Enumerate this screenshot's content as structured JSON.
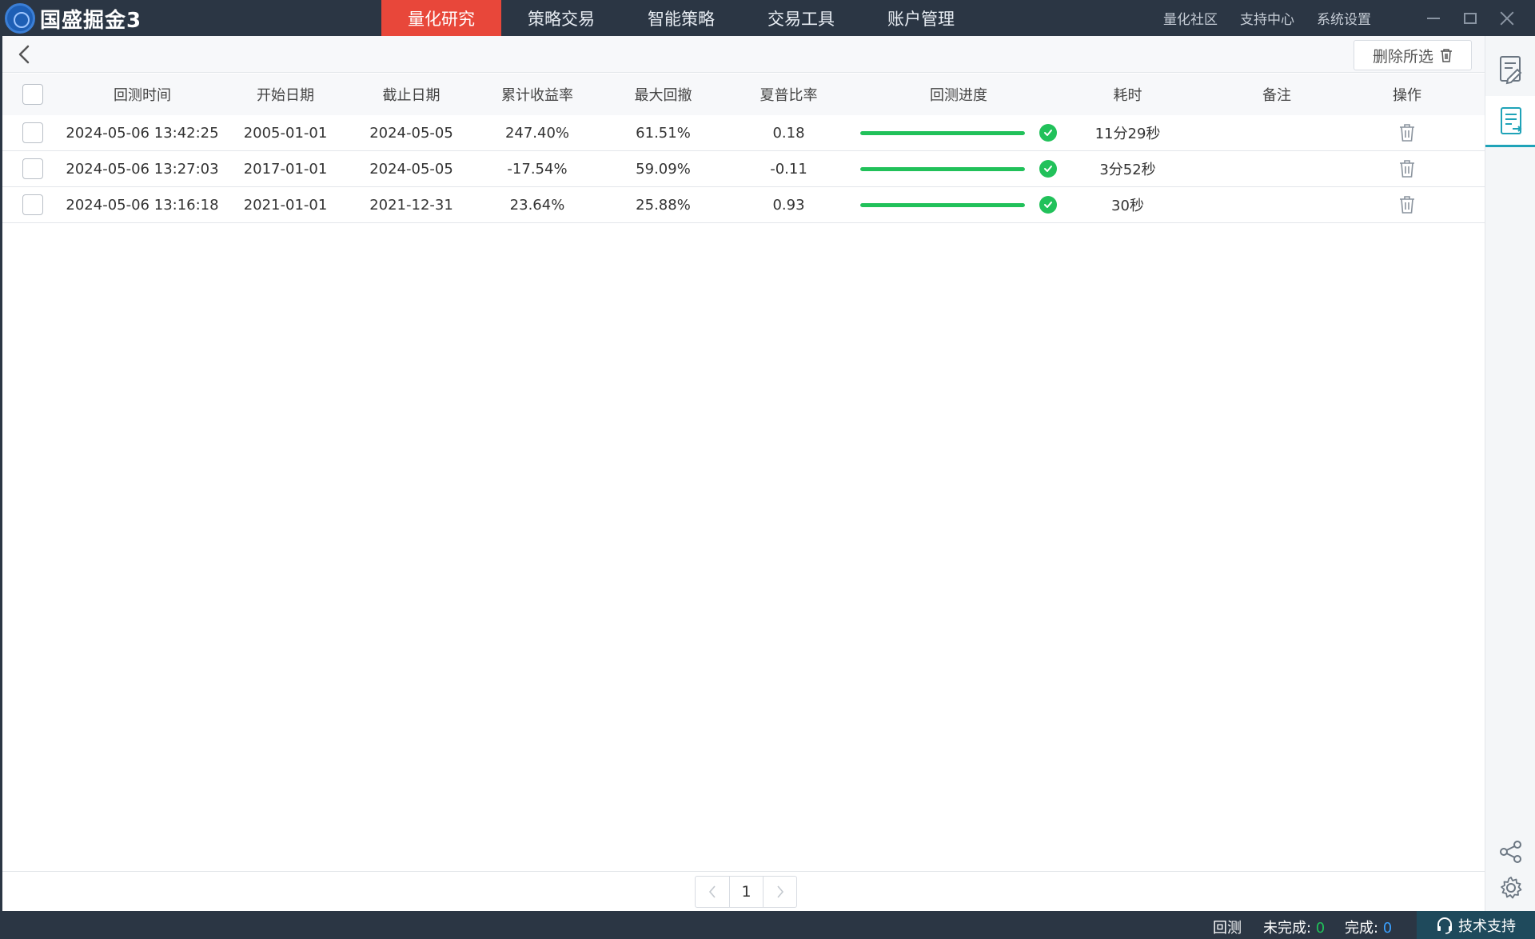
{
  "app": {
    "title": "国盛掘金3"
  },
  "nav": {
    "tabs": [
      {
        "label": "量化研究",
        "active": true
      },
      {
        "label": "策略交易",
        "active": false
      },
      {
        "label": "智能策略",
        "active": false
      },
      {
        "label": "交易工具",
        "active": false
      },
      {
        "label": "账户管理",
        "active": false
      }
    ]
  },
  "toplinks": [
    "量化社区",
    "支持中心",
    "系统设置"
  ],
  "toolbar": {
    "delete_label": "删除所选"
  },
  "table": {
    "headers": [
      "回测时间",
      "开始日期",
      "截止日期",
      "累计收益率",
      "最大回撤",
      "夏普比率",
      "回测进度",
      "耗时",
      "备注",
      "操作"
    ],
    "rows": [
      {
        "time": "2024-05-06 13:42:25",
        "start": "2005-01-01",
        "end": "2024-05-05",
        "return": "247.40%",
        "drawdown": "61.51%",
        "sharpe": "0.18",
        "progress": 1.0,
        "cost": "11分29秒",
        "note": ""
      },
      {
        "time": "2024-05-06 13:27:03",
        "start": "2017-01-01",
        "end": "2024-05-05",
        "return": "-17.54%",
        "drawdown": "59.09%",
        "sharpe": "-0.11",
        "progress": 1.0,
        "cost": "3分52秒",
        "note": ""
      },
      {
        "time": "2024-05-06 13:16:18",
        "start": "2021-01-01",
        "end": "2021-12-31",
        "return": "23.64%",
        "drawdown": "25.88%",
        "sharpe": "0.93",
        "progress": 1.0,
        "cost": "30秒",
        "note": ""
      }
    ]
  },
  "pager": {
    "current": "1"
  },
  "status": {
    "backtest": "回测",
    "pending_label": "未完成: ",
    "pending_count": "0",
    "done_label": "完成: ",
    "done_count": "0",
    "support": "技术支持"
  },
  "colors": {
    "accent": "#e8473a",
    "titlebar": "#2b3644",
    "progress": "#21c15a",
    "teal": "#1fa3b8"
  },
  "icons": {
    "back": "chevron-left-icon",
    "delete": "trash-icon",
    "done": "check-circle-icon",
    "sidebar": [
      "edit-doc-icon",
      "doc-list-icon",
      "share-icon",
      "gear-icon"
    ],
    "support": "headset-icon"
  }
}
